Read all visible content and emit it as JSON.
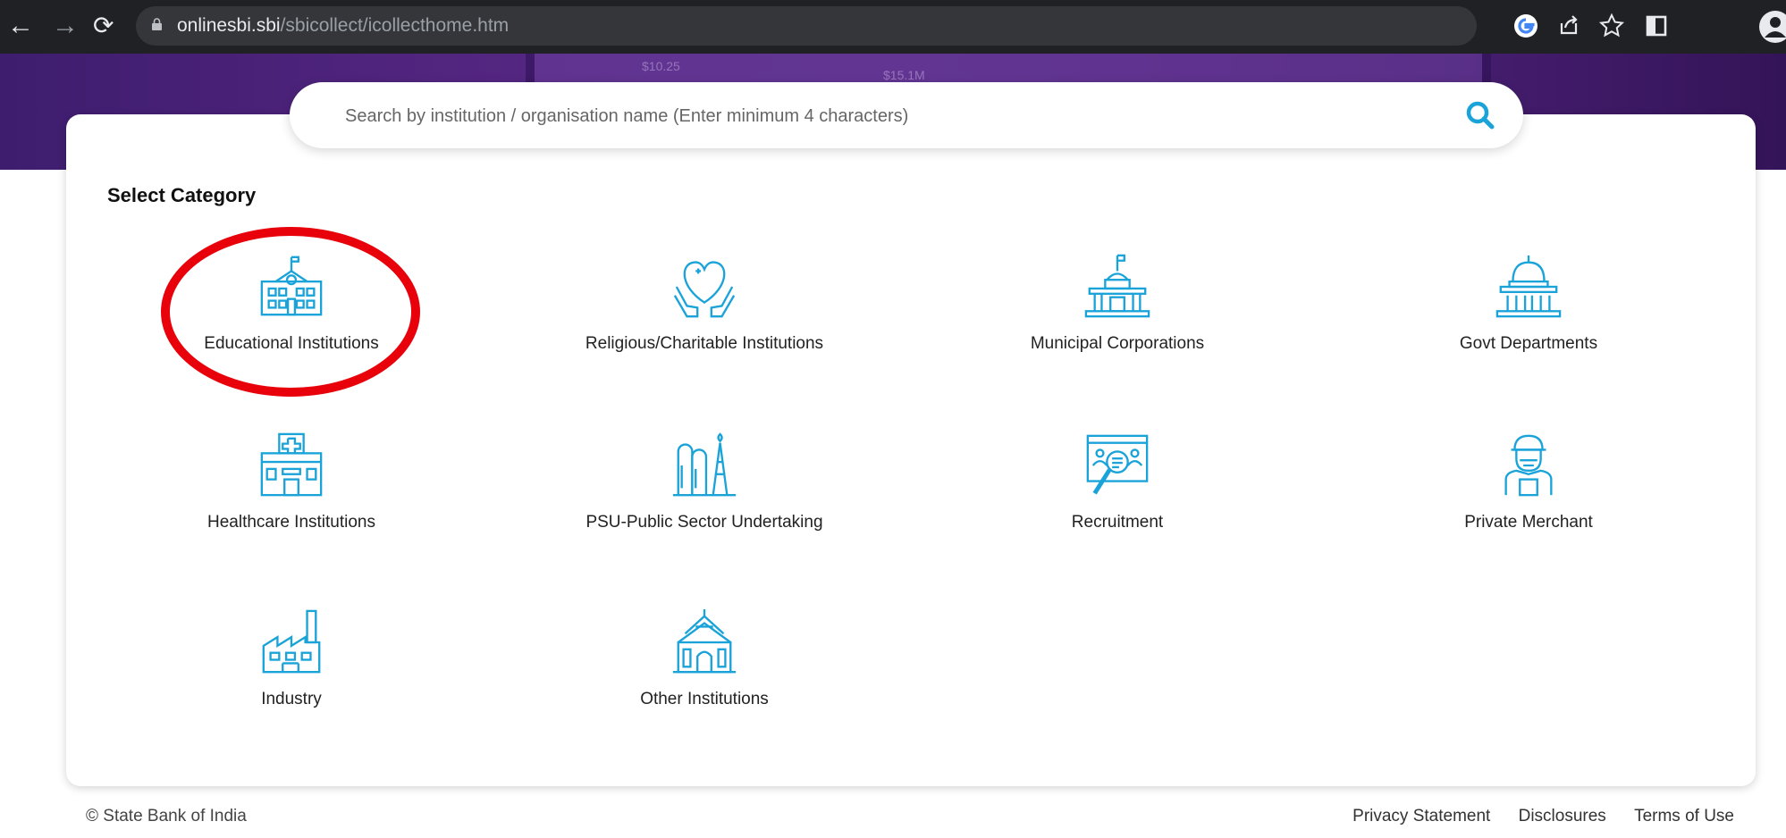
{
  "browser": {
    "url_domain": "onlinesbi.sbi",
    "url_path": "/sbicollect/icollecthome.htm"
  },
  "hero": {
    "numbers": [
      "$10.25",
      "$15.1M"
    ]
  },
  "search": {
    "placeholder": "Search by institution / organisation name (Enter minimum 4 characters)"
  },
  "section_title": "Select Category",
  "categories": [
    {
      "label": "Educational Institutions",
      "icon": "school-icon"
    },
    {
      "label": "Religious/Charitable Institutions",
      "icon": "heart-hands-icon"
    },
    {
      "label": "Municipal Corporations",
      "icon": "municipal-building-icon"
    },
    {
      "label": "Govt Departments",
      "icon": "capitol-dome-icon"
    },
    {
      "label": "Healthcare Institutions",
      "icon": "hospital-icon"
    },
    {
      "label": "PSU-Public Sector Undertaking",
      "icon": "refinery-icon"
    },
    {
      "label": "Recruitment",
      "icon": "recruitment-search-icon"
    },
    {
      "label": "Private Merchant",
      "icon": "merchant-person-icon"
    },
    {
      "label": "Industry",
      "icon": "factory-icon"
    },
    {
      "label": "Other Institutions",
      "icon": "temple-icon"
    }
  ],
  "footer": {
    "copyright": "© State Bank of India",
    "links": [
      "Privacy Statement",
      "Disclosures",
      "Terms of Use"
    ]
  },
  "colors": {
    "icon": "#1aa3d9",
    "highlight": "#e8000b",
    "hero": "#52257f"
  }
}
